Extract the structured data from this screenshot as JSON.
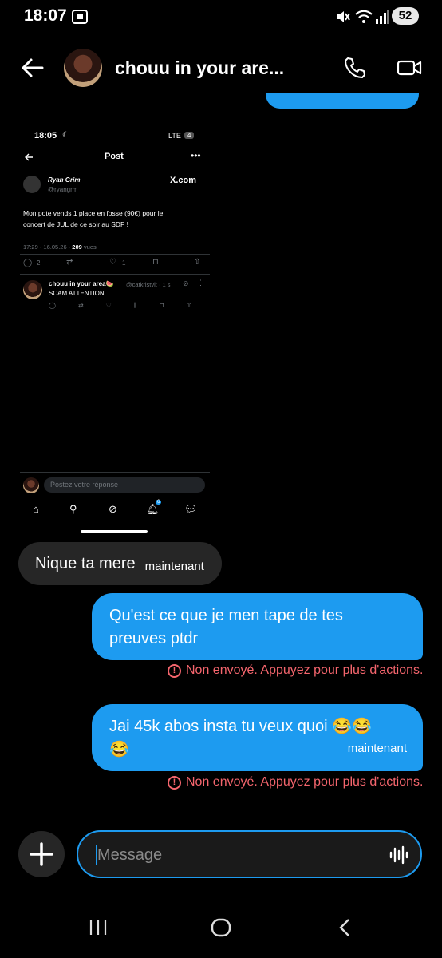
{
  "status_bar": {
    "time": "18:07",
    "battery": "52"
  },
  "header": {
    "title": "chouu in your are..."
  },
  "screenshot": {
    "time": "18:05",
    "network": "LTE",
    "network_badge": "4",
    "post_title": "Post",
    "author_name": "Ryan Grim",
    "author_handle": "@ryangrm",
    "source": "X.com",
    "post_text_line1": "Mon pote vends 1 place en fosse (90€) pour le",
    "post_text_line2": "concert de JUL de ce soir au SDF !",
    "meta_time": "17:29 · 16.05.26 · ",
    "meta_views": "209",
    "meta_views_label": " vues",
    "replies": "2",
    "likes": "1",
    "reply_author": "chouu in your area🍉",
    "reply_handle": "@catkristvit · 1 s",
    "reply_text": "SCAM ATTENTION",
    "reply_placeholder": "Postez votre réponse",
    "notif_count": "6"
  },
  "messages": {
    "received": {
      "text": "Nique ta mere",
      "time": "maintenant"
    },
    "sent1": {
      "line1": "Qu'est ce que je men tape de tes",
      "line2": "preuves ptdr"
    },
    "sent2": {
      "line1": "Jai 45k abos insta tu veux quoi 😂😂",
      "line2": "😂",
      "time": "maintenant"
    },
    "error": "Non envoyé. Appuyez pour plus d'actions."
  },
  "composer": {
    "placeholder": "Message"
  }
}
